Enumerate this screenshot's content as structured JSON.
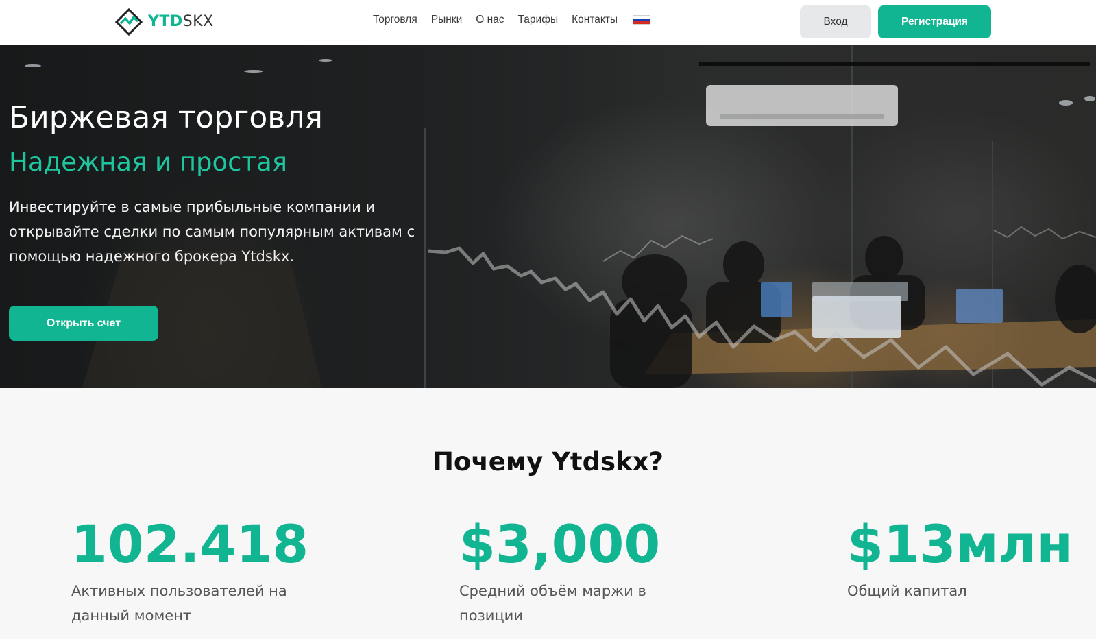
{
  "brand": {
    "part1": "YTD",
    "part2": "SKX",
    "accent": "#12b592"
  },
  "nav": {
    "items": [
      "Торговля",
      "Рынки",
      "О нас",
      "Тарифы",
      "Контакты"
    ],
    "language_icon": "russia-flag-icon"
  },
  "header": {
    "login_label": "Вход",
    "register_label": "Регистрация"
  },
  "hero": {
    "title": "Биржевая торговля",
    "subtitle": "Надежная и простая",
    "description": "Инвестируйте в самые прибыльные компании и открывайте сделки по самым популярным активам с помощью надежного брокера Ytdskx.",
    "cta_label": "Открыть счет"
  },
  "why": {
    "title": "Почему Ytdskx?",
    "stats": [
      {
        "value": "102.418",
        "label": "Активных пользователей на данный момент"
      },
      {
        "value": "$3,000",
        "label": "Средний объём маржи в позиции"
      },
      {
        "value": "$13млн",
        "label": "Общий капитал"
      }
    ]
  }
}
